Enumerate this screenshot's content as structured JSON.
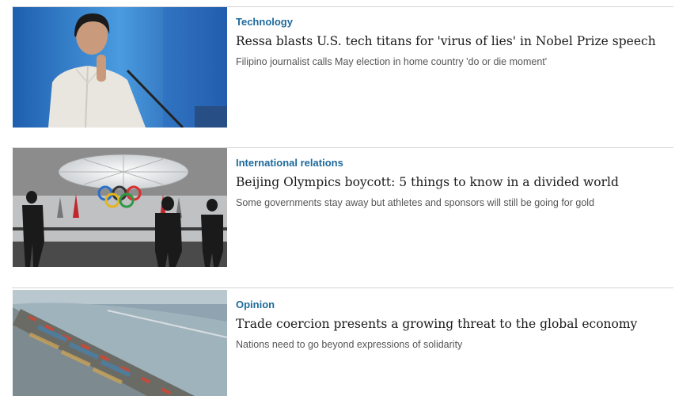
{
  "articles": [
    {
      "category": "Technology",
      "headline": "Ressa blasts U.S. tech titans for 'virus of lies' in Nobel Prize speech",
      "summary": "Filipino journalist calls May election in home country 'do or die moment'",
      "image": "photo-journalist-at-podium"
    },
    {
      "category": "International relations",
      "headline": "Beijing Olympics boycott: 5 things to know in a divided world",
      "summary": "Some governments stay away but athletes and sponsors will still be going for gold",
      "image": "photo-olympic-rings-exhibition"
    },
    {
      "category": "Opinion",
      "headline": "Trade coercion presents a growing threat to the global economy",
      "summary": "Nations need to go beyond expressions of solidarity",
      "image": "photo-container-port-aerial"
    }
  ],
  "colors": {
    "category": "#1d6a9c",
    "headline": "#1a1a1a",
    "summary": "#555555",
    "divider": "#d4d4d4"
  }
}
